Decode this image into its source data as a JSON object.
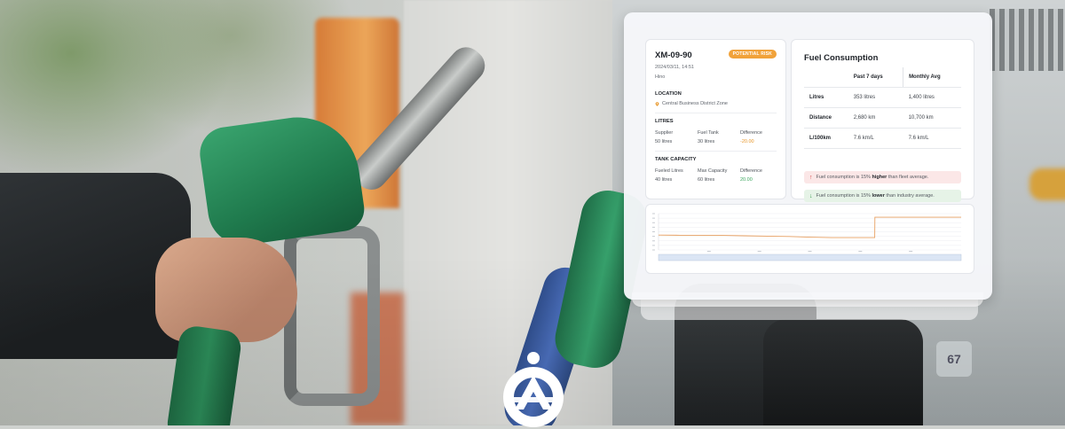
{
  "vehicle": {
    "id": "XM-09-90",
    "status_badge": "POTENTIAL RISK",
    "datetime": "2024/03/11, 14:51",
    "make": "Hino",
    "location_label": "LOCATION",
    "location_value": "Central Business District Zone",
    "litres_label": "LITRES",
    "litres": {
      "supplier_label": "Supplier",
      "supplier_value": "50 litres",
      "tank_label": "Fuel Tank",
      "tank_value": "30 litres",
      "diff_label": "Difference",
      "diff_value": "-20.00"
    },
    "tank_label": "TANK CAPACITY",
    "tank": {
      "fueled_label": "Fueled Litres",
      "fueled_value": "40 litres",
      "max_label": "Max Capacity",
      "max_value": "60 litres",
      "diff_label": "Difference",
      "diff_value": "20.00"
    }
  },
  "fuel_consumption": {
    "title": "Fuel Consumption",
    "columns": [
      "Past 7 days",
      "Monthly Avg"
    ],
    "rows": [
      {
        "label": "Litres",
        "past": "353 litres",
        "monthly": "1,400 litres"
      },
      {
        "label": "Distance",
        "past": "2,680 km",
        "monthly": "10,700 km"
      },
      {
        "label": "L/100km",
        "past": "7.6 km/L",
        "monthly": "7.6 km/L"
      }
    ],
    "alerts": [
      {
        "pre": "Fuel consumption is 15% ",
        "bold": "higher",
        "post": " than fleet average.",
        "tone": "red"
      },
      {
        "pre": "Fuel consumption is 15% ",
        "bold": "lower",
        "post": " than industry average.",
        "tone": "green"
      }
    ]
  },
  "colors": {
    "accent_orange": "#e8982c",
    "badge_orange": "#f1a23a",
    "positive_green": "#3aa55c",
    "alert_red": "#d34b4b"
  },
  "icons": {
    "location": "map-pin-icon",
    "alert_up": "arrow-up-icon",
    "alert_down": "arrow-down-icon",
    "brand": "brand-logo-icon"
  },
  "chart_data": {
    "type": "line",
    "series": [
      {
        "values": [
          8.2,
          8.1,
          8.1,
          8.0,
          7.8,
          7.6,
          7.4,
          7.0,
          6.8,
          6.8,
          6.8,
          18.0,
          18.0,
          18.0,
          18.0,
          18.0
        ]
      }
    ],
    "x": [
      0,
      1,
      2,
      3,
      4,
      5,
      6,
      7,
      8,
      9,
      10,
      10.01,
      11,
      12,
      13,
      14
    ],
    "xlim": [
      0,
      14
    ],
    "ylim": [
      0,
      20
    ],
    "grid": true,
    "range_selector": true
  }
}
